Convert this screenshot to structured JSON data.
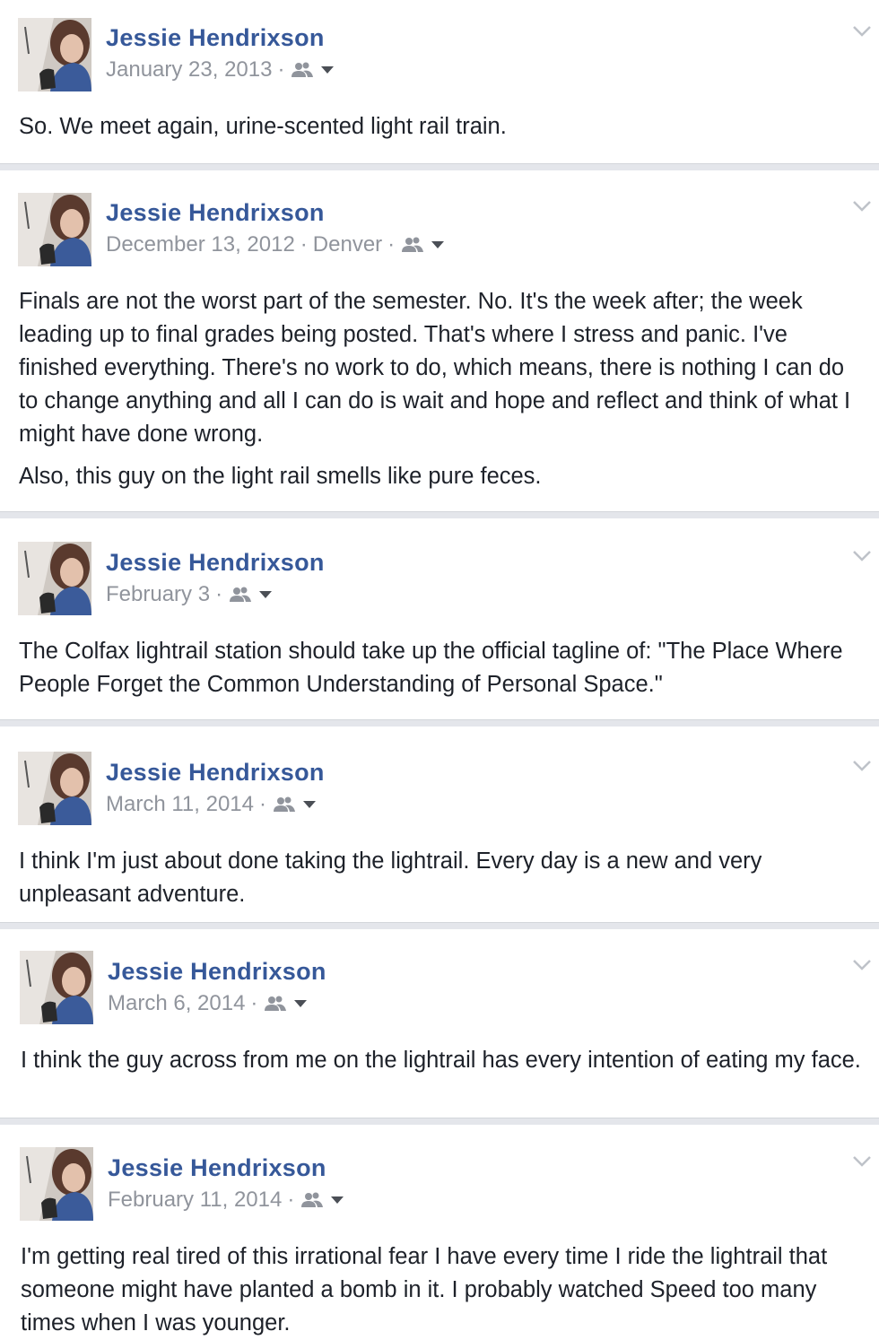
{
  "posts": [
    {
      "author": "Jessie Hendrixson",
      "date": "January 23, 2013",
      "location": "",
      "paragraphs": [
        "So. We meet again, urine-scented light rail train."
      ]
    },
    {
      "author": "Jessie Hendrixson",
      "date": "December 13, 2012",
      "location": "Denver",
      "paragraphs": [
        "Finals are not the worst part of the semester. No. It's the week after; the week leading up to final grades being posted. That's where I stress and panic. I've finished everything. There's no work to do, which means, there is nothing I can do to change anything and all I can do is wait and hope and reflect and think of what I might have done wrong.",
        "Also, this guy on the light rail smells like pure feces."
      ]
    },
    {
      "author": "Jessie Hendrixson",
      "date": "February 3",
      "location": "",
      "paragraphs": [
        "The Colfax lightrail station should take up the official tagline of: \"The Place Where People Forget the Common Understanding of Personal Space.\""
      ]
    },
    {
      "author": "Jessie Hendrixson",
      "date": "March 11, 2014",
      "location": "",
      "paragraphs": [
        "I think I'm just about done taking the lightrail. Every day is a new and very unpleasant adventure."
      ]
    },
    {
      "author": "Jessie Hendrixson",
      "date": "March 6, 2014",
      "location": "",
      "paragraphs": [
        "I think the guy across from me on the lightrail has every intention of eating my face."
      ]
    },
    {
      "author": "Jessie Hendrixson",
      "date": "February 11, 2014",
      "location": "",
      "paragraphs": [
        "I'm getting real tired of this irrational fear I have every time I ride the lightrail that someone might have planted a bomb in it. I probably watched Speed too many times when I was younger."
      ]
    }
  ],
  "meta_separator": "·",
  "icons": {
    "audience": "friends-icon",
    "audience_menu": "caret-down-icon",
    "post_menu": "chevron-down-icon"
  },
  "colors": {
    "author_name": "#365899",
    "meta_text": "#90949c",
    "body_text": "#1d2129",
    "separator": "#e4e6eb"
  }
}
